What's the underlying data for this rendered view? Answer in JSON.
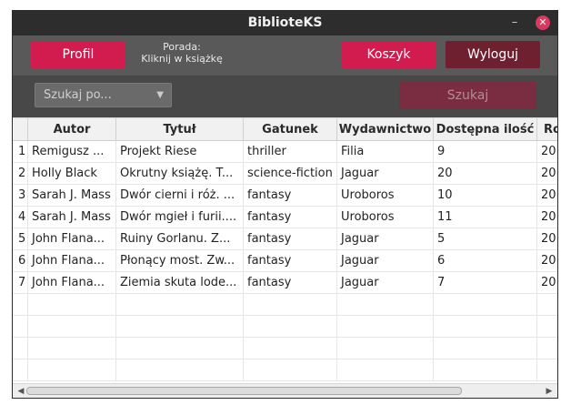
{
  "window": {
    "title": "BiblioteKS",
    "minimize_glyph": "–",
    "close_glyph": "✕"
  },
  "toolbar": {
    "profil_label": "Profil",
    "tip_line1": "Porada:",
    "tip_line2": "Kliknij w książkę",
    "koszyk_label": "Koszyk",
    "wyloguj_label": "Wyloguj"
  },
  "search": {
    "select_value": "Szukaj po...",
    "button_label": "Szukaj"
  },
  "table": {
    "columns": [
      "",
      "Autor",
      "Tytuł",
      "Gatunek",
      "Wydawnictwo",
      "Dostępna ilość",
      "Ro"
    ],
    "rows": [
      [
        "1",
        "Remigusz ...",
        "Projekt Riese",
        "thriller",
        "Filia",
        "9",
        "20"
      ],
      [
        "2",
        "Holly Black",
        "Okrutny książę. T...",
        "science-fiction",
        "Jaguar",
        "20",
        "20"
      ],
      [
        "3",
        "Sarah J. Mass",
        "Dwór cierni i róż. ...",
        "fantasy",
        "Uroboros",
        "10",
        "20"
      ],
      [
        "4",
        "Sarah J. Mass",
        "Dwór mgieł i furii....",
        "fantasy",
        "Uroboros",
        "11",
        "20"
      ],
      [
        "5",
        "John Flana...",
        "Ruiny Gorlanu. Z...",
        "fantasy",
        "Jaguar",
        "5",
        "20"
      ],
      [
        "6",
        "John Flana...",
        "Płonący most. Zw...",
        "fantasy",
        "Jaguar",
        "6",
        "20"
      ],
      [
        "7",
        "John Flana...",
        "Ziemia skuta lode...",
        "fantasy",
        "Jaguar",
        "7",
        "20"
      ]
    ],
    "empty_rows": 4
  },
  "colors": {
    "accent": "#d21b4e",
    "logout": "#6e1f30",
    "toolbar": "#595959",
    "search_bar": "#484848",
    "titlebar": "#2d2d2d"
  },
  "icons": {
    "select_chevron": "chevron-down-icon",
    "scroll_left": "arrow-left-icon",
    "scroll_right": "arrow-right-icon"
  }
}
